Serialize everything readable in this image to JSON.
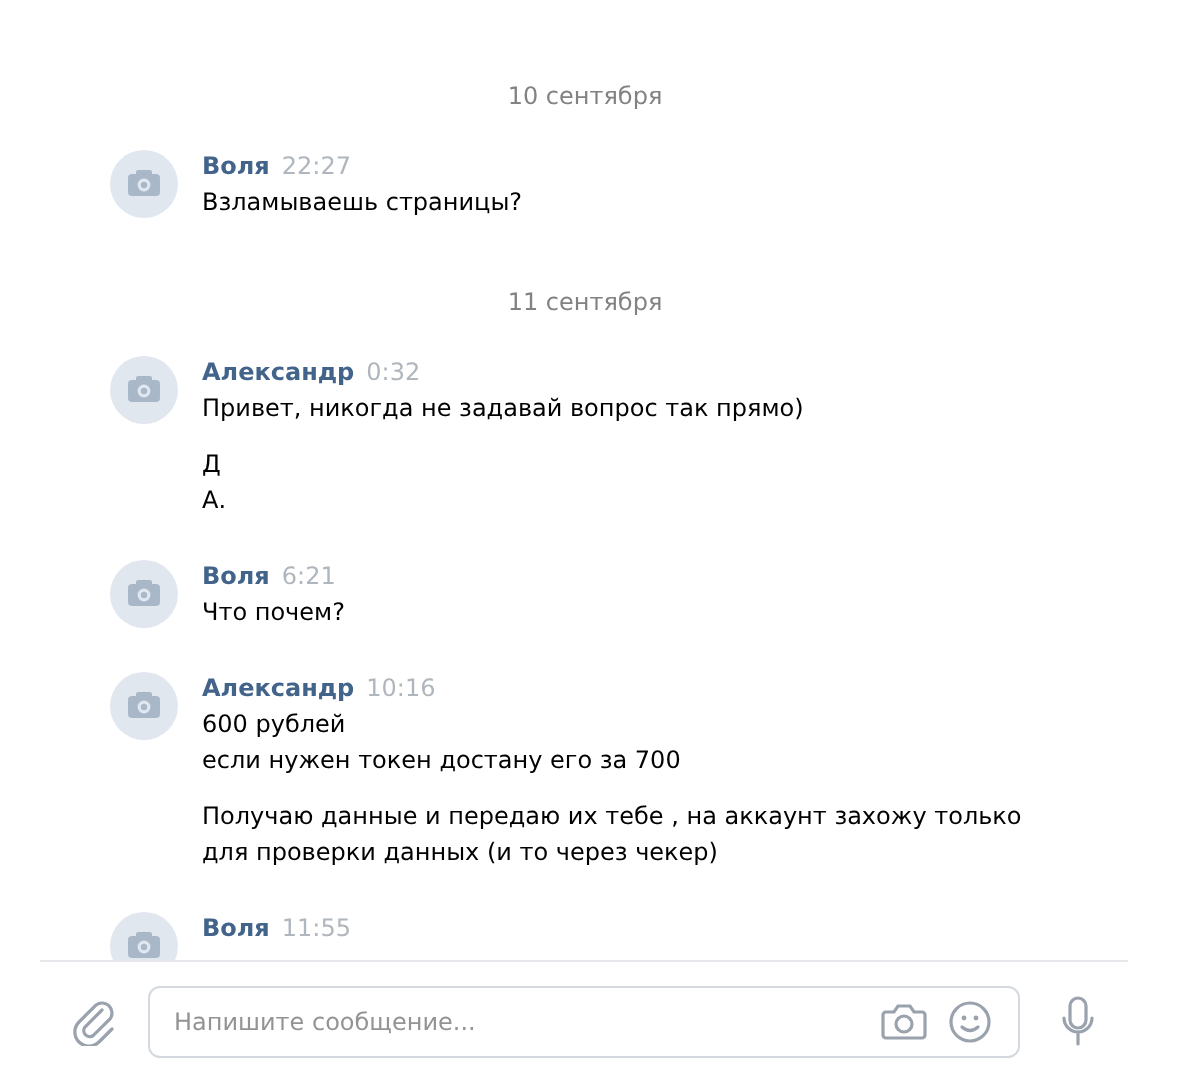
{
  "feed": [
    {
      "kind": "date",
      "text": "10 сентября"
    },
    {
      "kind": "message",
      "author": "Воля",
      "time": "22:27",
      "paragraphs": [
        [
          "Взламываешь страницы?"
        ]
      ]
    },
    {
      "kind": "date",
      "text": "11 сентября"
    },
    {
      "kind": "message",
      "author": "Александр",
      "time": "0:32",
      "paragraphs": [
        [
          "Привет, никогда не задавай вопрос так прямо)"
        ],
        [
          "Д",
          "А."
        ]
      ]
    },
    {
      "kind": "message",
      "author": "Воля",
      "time": "6:21",
      "paragraphs": [
        [
          "Что почем?"
        ]
      ]
    },
    {
      "kind": "message",
      "author": "Александр",
      "time": "10:16",
      "paragraphs": [
        [
          "600 рублей",
          "если нужен токен достану его за 700"
        ],
        [
          "Получаю данные и передаю их тебе , на аккаунт захожу только",
          "для проверки данных (и то через чекер)"
        ]
      ]
    },
    {
      "kind": "message",
      "author": "Воля",
      "time": "11:55"
    }
  ],
  "composer": {
    "placeholder": "Напишите сообщение..."
  }
}
